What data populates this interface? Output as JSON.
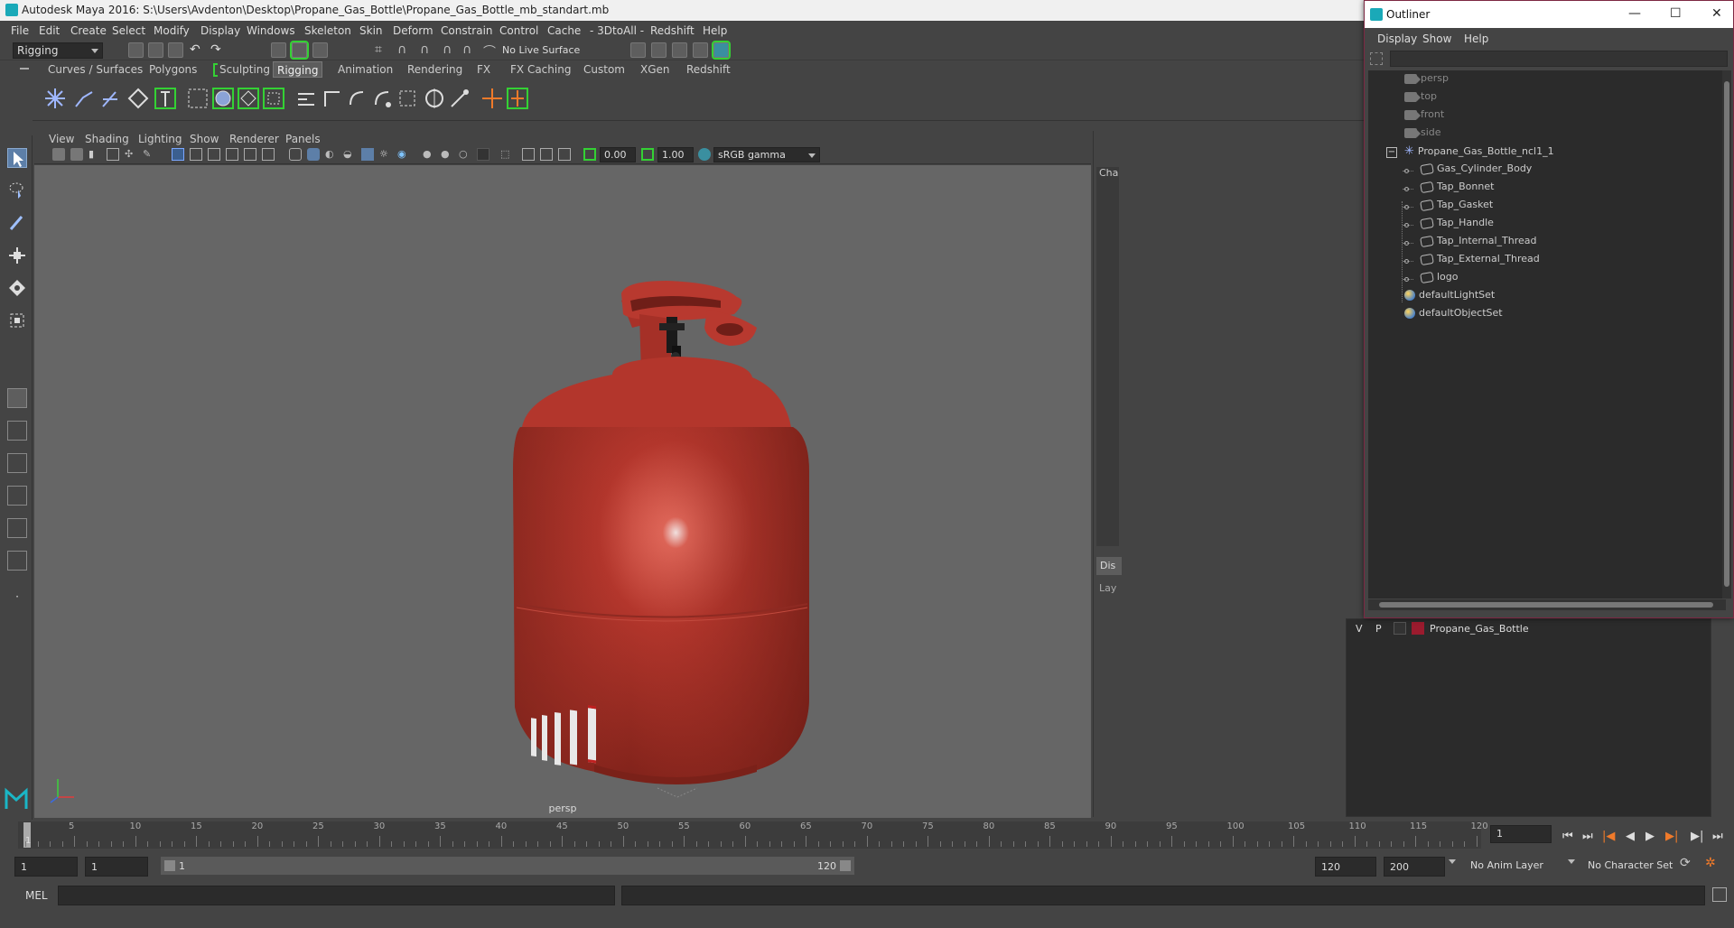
{
  "window": {
    "title": "Autodesk Maya 2016: S:\\Users\\Avdenton\\Desktop\\Propane_Gas_Bottle\\Propane_Gas_Bottle_mb_standart.mb"
  },
  "menubar": [
    "File",
    "Edit",
    "Create",
    "Select",
    "Modify",
    "Display",
    "Windows",
    "Skeleton",
    "Skin",
    "Deform",
    "Constrain",
    "Control",
    "Cache",
    "- 3DtoAll -",
    "Redshift",
    "Help"
  ],
  "status": {
    "mode": "Rigging",
    "live_surface": "No Live Surface"
  },
  "shelf_tabs": [
    "Curves / Surfaces",
    "Polygons",
    "Sculpting",
    "Rigging",
    "Animation",
    "Rendering",
    "FX",
    "FX Caching",
    "Custom",
    "XGen",
    "Redshift"
  ],
  "shelf_active": "Rigging",
  "panel_menu": [
    "View",
    "Shading",
    "Lighting",
    "Show",
    "Renderer",
    "Panels"
  ],
  "panel_tools": {
    "exposure": "0.00",
    "gamma": "1.00",
    "colorspace": "sRGB gamma"
  },
  "viewport": {
    "camera_label": "persp"
  },
  "outliner": {
    "title": "Outliner",
    "menu": [
      "Display",
      "Show",
      "Help"
    ],
    "items": [
      {
        "label": "persp",
        "type": "camera"
      },
      {
        "label": "top",
        "type": "camera"
      },
      {
        "label": "front",
        "type": "camera"
      },
      {
        "label": "side",
        "type": "camera"
      },
      {
        "label": "Propane_Gas_Bottle_ncl1_1",
        "type": "group"
      },
      {
        "label": "Gas_Cylinder_Body",
        "type": "mesh"
      },
      {
        "label": "Tap_Bonnet",
        "type": "mesh"
      },
      {
        "label": "Tap_Gasket",
        "type": "mesh"
      },
      {
        "label": "Tap_Handle",
        "type": "mesh"
      },
      {
        "label": "Tap_Internal_Thread",
        "type": "mesh"
      },
      {
        "label": "Tap_External_Thread",
        "type": "mesh"
      },
      {
        "label": "logo",
        "type": "mesh"
      },
      {
        "label": "defaultLightSet",
        "type": "set"
      },
      {
        "label": "defaultObjectSet",
        "type": "set"
      }
    ]
  },
  "side_panel": {
    "channel_tab": "Cha",
    "display_tab": "Dis",
    "layers_tab": "Lay"
  },
  "layers": [
    {
      "v": "V",
      "p": "P",
      "name": "Propane_Gas_Bottle",
      "color": "#9b1b2e"
    }
  ],
  "timeline": {
    "ticks": [
      "5",
      "10",
      "15",
      "20",
      "25",
      "30",
      "35",
      "40",
      "45",
      "50",
      "55",
      "60",
      "65",
      "70",
      "75",
      "80",
      "85",
      "90",
      "95",
      "100",
      "105",
      "110",
      "115",
      "120"
    ],
    "start_marker": "1",
    "current_frame": "1"
  },
  "range": {
    "start": "1",
    "playback_start": "1",
    "range_start_label": "1",
    "range_end_label": "120",
    "playback_end": "120",
    "end": "200",
    "anim_layer": "No Anim Layer",
    "char_set": "No Character Set"
  },
  "command": {
    "label": "MEL"
  },
  "colors": {
    "accent_green": "#34d134",
    "outliner_border": "#7c2742",
    "bottle": "#b3362c"
  }
}
